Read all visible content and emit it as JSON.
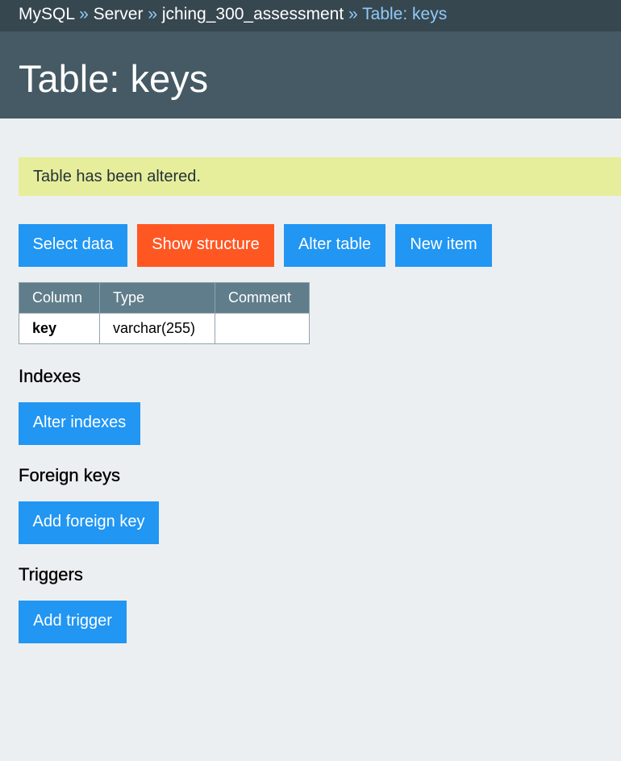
{
  "breadcrumb": {
    "items": [
      "MySQL",
      "Server",
      "jching_300_assessment"
    ],
    "separator": "»",
    "current": "Table: keys"
  },
  "header": {
    "title": "Table: keys"
  },
  "message": "Table has been altered.",
  "actions": {
    "select_data": "Select data",
    "show_structure": "Show structure",
    "alter_table": "Alter table",
    "new_item": "New item"
  },
  "table": {
    "headers": [
      "Column",
      "Type",
      "Comment"
    ],
    "rows": [
      {
        "column": "key",
        "type": "varchar(255)",
        "comment": ""
      }
    ]
  },
  "indexes": {
    "title": "Indexes",
    "button": "Alter indexes"
  },
  "foreign_keys": {
    "title": "Foreign keys",
    "button": "Add foreign key"
  },
  "triggers": {
    "title": "Triggers",
    "button": "Add trigger"
  },
  "colors": {
    "primary": "#2196f3",
    "active": "#ff5722",
    "breadcrumb_bg": "#37474f",
    "header_bg": "#455a64",
    "message_bg": "#e6ee9c",
    "table_header_bg": "#607d8b",
    "page_bg": "#eceff1"
  }
}
